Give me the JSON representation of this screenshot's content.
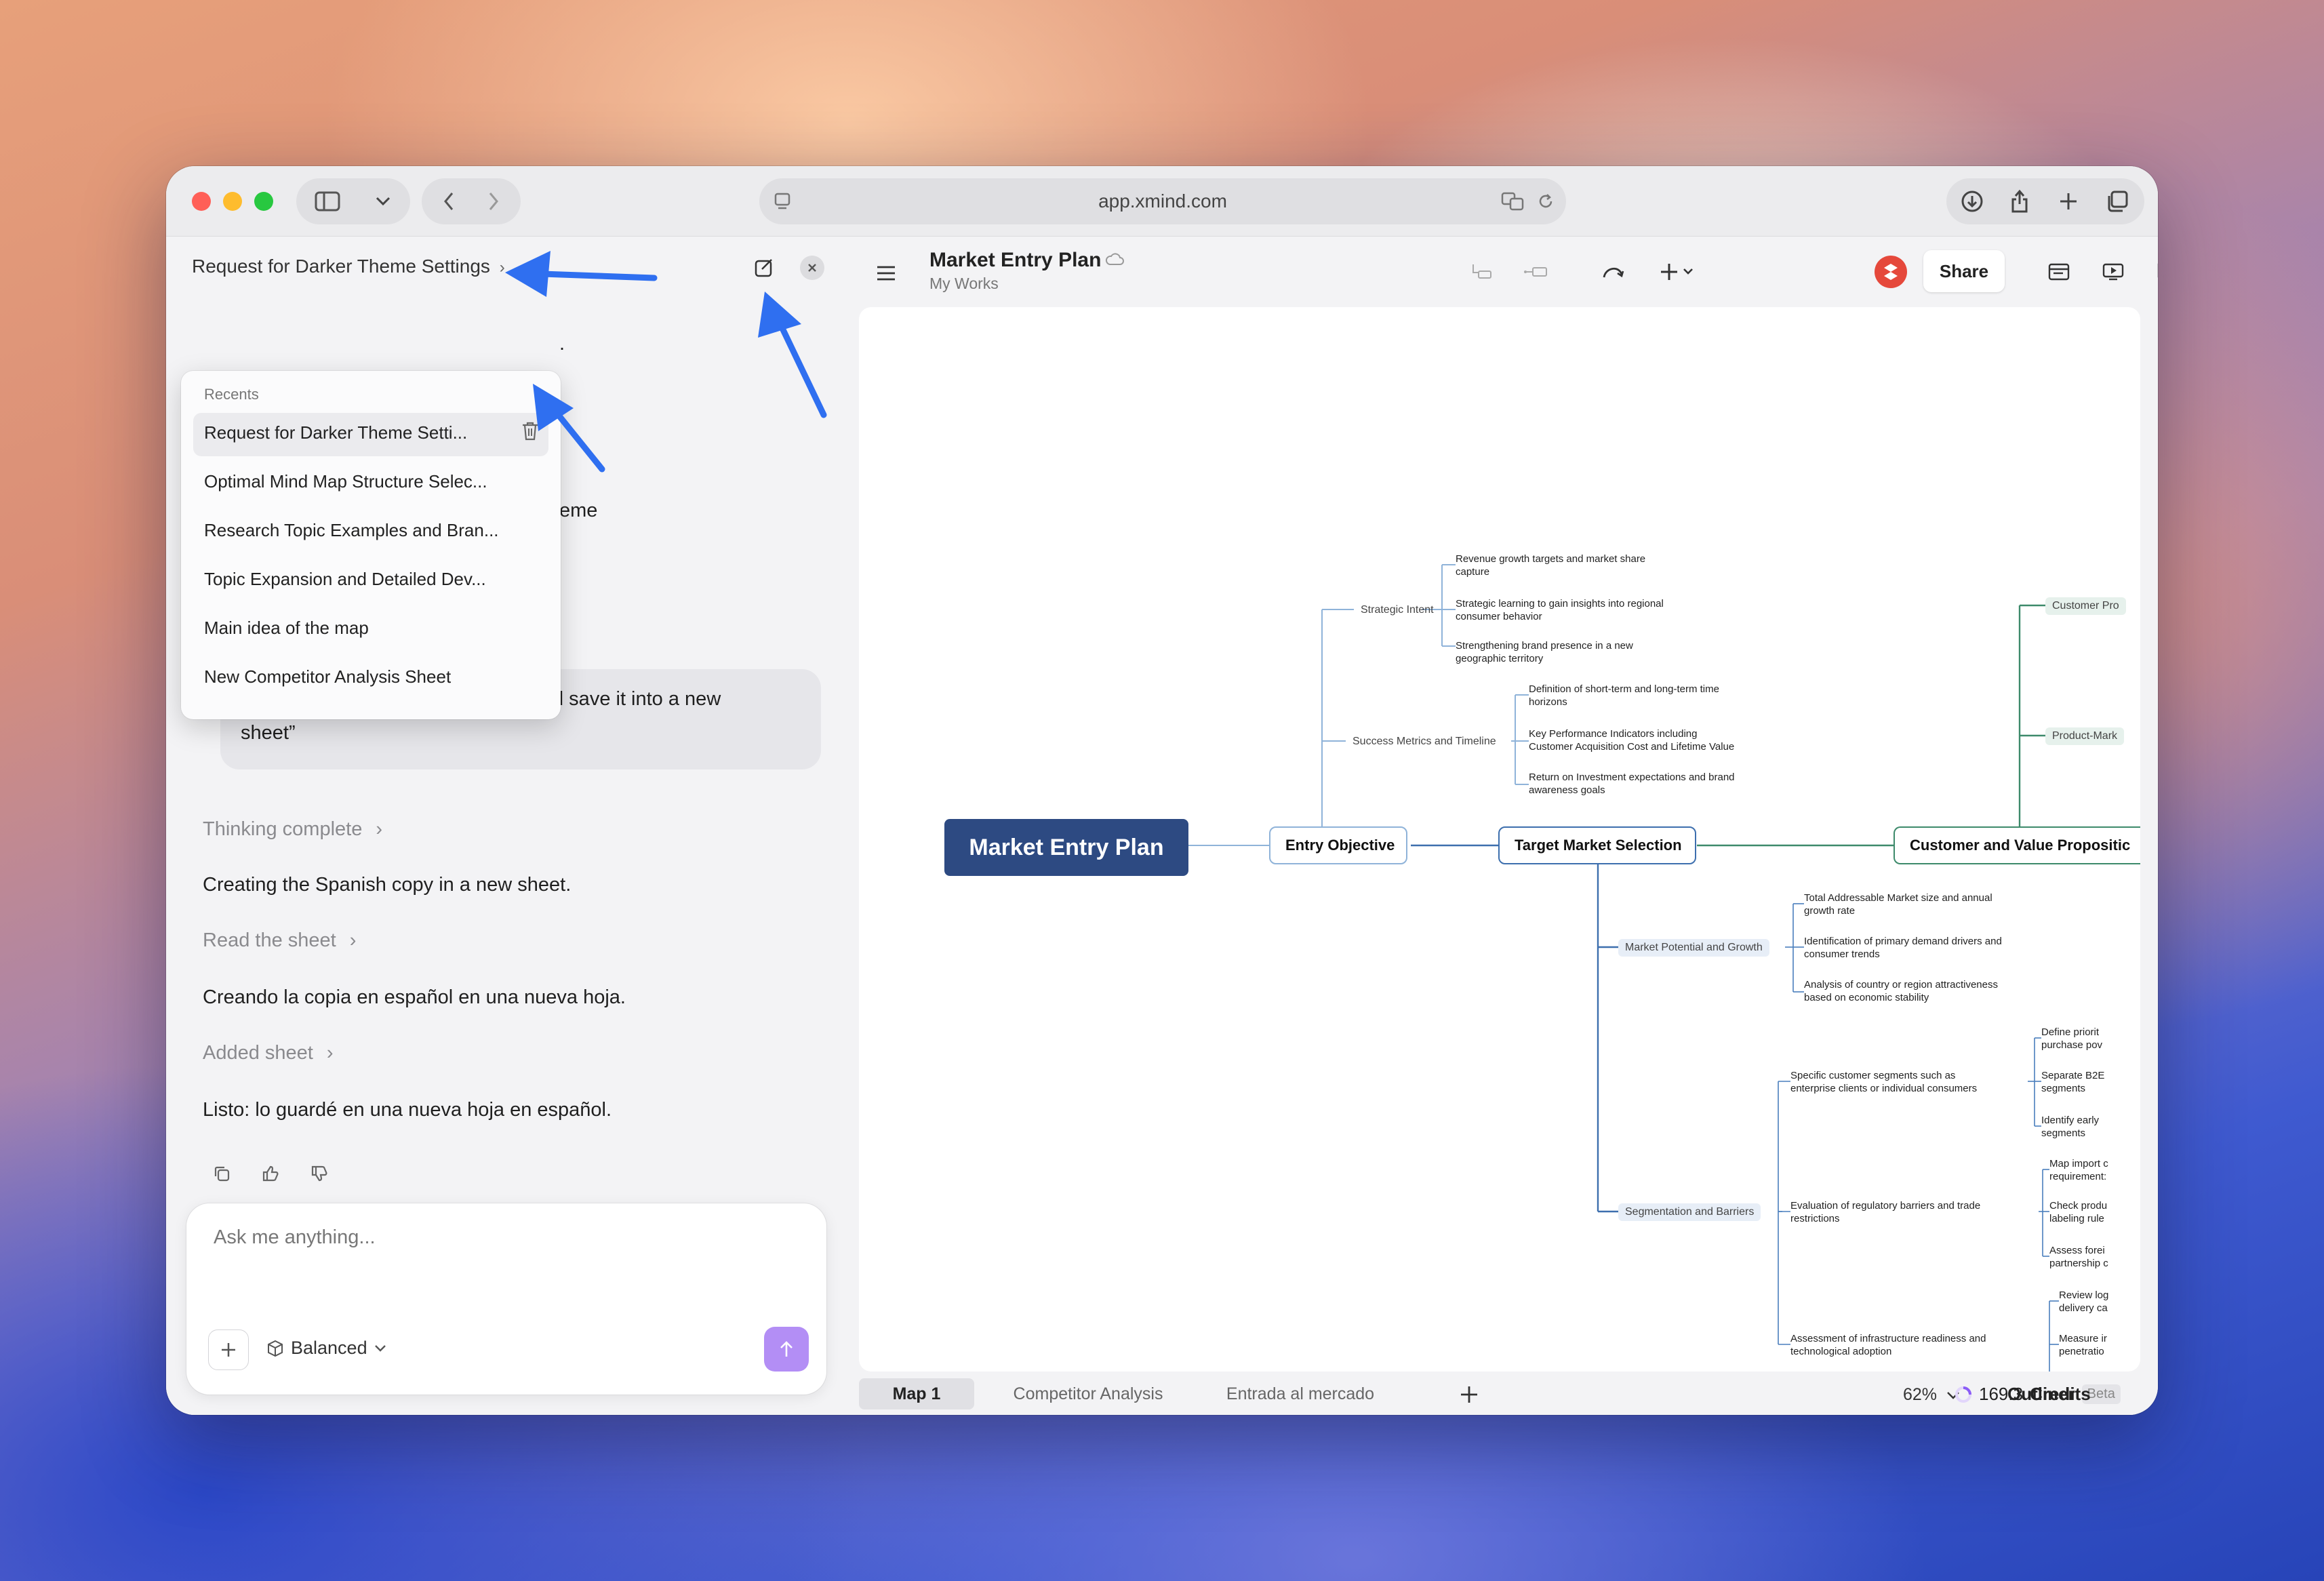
{
  "browser": {
    "url": "app.xmind.com"
  },
  "sidebar": {
    "conversation_title": "Request for Darker Theme Settings",
    "recents": {
      "label": "Recents",
      "items": [
        "Request for Darker Theme Setti...",
        "Optimal Mind Map Structure Selec...",
        "Research Topic Examples and Bran...",
        "Topic Expansion and Detailed Dev...",
        "Main idea of the map",
        "New Competitor Analysis Sheet"
      ]
    },
    "partial_hidden_1": ".",
    "partial_hidden_2": "eme",
    "user_message_line1": "d save it into a new",
    "user_message_line2": "sheet”",
    "thinking": "Thinking complete",
    "msg1": "Creating the Spanish copy in a new sheet.",
    "step_read": "Read the sheet",
    "msg2": "Creando la copia en español en una nueva hoja.",
    "step_added": "Added sheet",
    "msg3": "Listo: lo guardé en una nueva hoja en español.",
    "composer": {
      "placeholder": "Ask me anything...",
      "mode": "Balanced"
    }
  },
  "doc": {
    "title": "Market Entry Plan",
    "subtitle": "My Works",
    "share_label": "Share"
  },
  "map": {
    "root": "Market Entry Plan",
    "entry_objective": "Entry Objective",
    "target_market": "Target Market Selection",
    "customer_value": "Customer and Value Propositic",
    "strategic_intent": "Strategic Intent",
    "success_metrics": "Success Metrics and Timeline",
    "market_potential": "Market Potential and Growth",
    "segmentation": "Segmentation and Barriers",
    "customer_pro": "Customer Pro",
    "product_mark": "Product-Mark",
    "si_leaves": [
      [
        "Revenue growth targets and market share",
        "capture"
      ],
      [
        "Strategic learning to gain insights into regional",
        "consumer behavior"
      ],
      [
        "Strengthening brand presence in a new",
        "geographic territory"
      ]
    ],
    "sm_leaves": [
      [
        "Definition of short-term and long-term time",
        "horizons"
      ],
      [
        "Key Performance Indicators including",
        "Customer Acquisition Cost and Lifetime Value"
      ],
      [
        "Return on Investment expectations and brand",
        "awareness goals"
      ]
    ],
    "mp_leaves": [
      [
        "Total Addressable Market size and annual",
        "growth rate"
      ],
      [
        "Identification of primary demand drivers and",
        "consumer trends"
      ],
      [
        "Analysis of country or region attractiveness",
        "based on economic stability"
      ]
    ],
    "seg_leaves": [
      [
        "Specific customer segments such as",
        "enterprise clients or individual consumers"
      ],
      [
        "Evaluation of regulatory barriers and trade",
        "restrictions"
      ],
      [
        "Assessment of infrastructure readiness and",
        "technological adoption"
      ]
    ],
    "seg1_sub": [
      [
        "Define priorit",
        "purchase pov"
      ],
      [
        "Separate B2E",
        "segments"
      ],
      [
        "Identify early",
        "segments"
      ]
    ],
    "seg2_sub": [
      [
        "Map import c",
        "requirement:"
      ],
      [
        "Check produ",
        "labeling rule"
      ],
      [
        "Assess forei",
        "partnership c"
      ]
    ],
    "seg3_sub": [
      [
        "Review log",
        "delivery ca"
      ],
      [
        "Measure ir",
        "penetratio"
      ]
    ]
  },
  "footer": {
    "tabs": [
      "Map 1",
      "Competitor Analysis",
      "Entrada al mercado"
    ],
    "zoom": "62%",
    "outliner": "Outliner",
    "beta": "Beta",
    "credits_value": "169.3",
    "credits_label": "Credits"
  },
  "colors": {
    "accent_arrow": "#2f6ff0",
    "root_node": "#2d4a82",
    "blue_branch": "#4a7fbd",
    "green_branch": "#3d8a6b",
    "send_button": "#b38ef5"
  }
}
